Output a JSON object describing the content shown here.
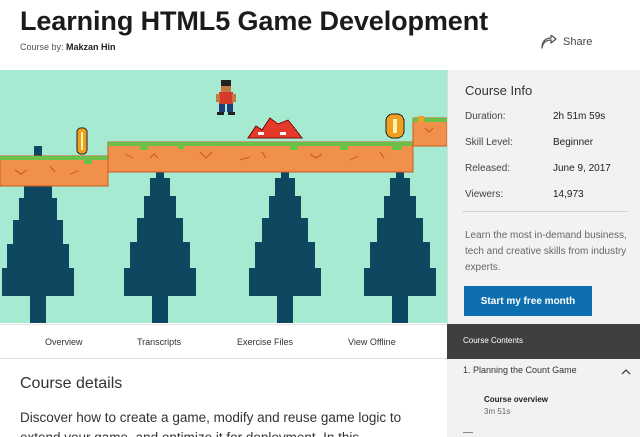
{
  "header": {
    "title": "Learning HTML5 Game Development",
    "byline_prefix": "Course by:",
    "author": "Makzan Hin",
    "share_label": "Share",
    "share_icon": "share-arrow-icon"
  },
  "course_info": {
    "title": "Course Info",
    "rows": [
      {
        "label": "Duration:",
        "value": "2h 51m 59s"
      },
      {
        "label": "Skill Level:",
        "value": "Beginner"
      },
      {
        "label": "Released:",
        "value": "June 9, 2017"
      },
      {
        "label": "Viewers:",
        "value": "14,973"
      }
    ],
    "description": "Learn the most in-demand business, tech and creative skills from industry experts.",
    "cta_label": "Start my free month",
    "cta_color": "#0d6faf"
  },
  "tabs": [
    "Overview",
    "Transcripts",
    "Exercise Files",
    "View Offline"
  ],
  "details": {
    "title": "Course details",
    "text": "Discover how to create a game, modify and reuse game logic to extend your game, and optimize it for deployment. In this"
  },
  "contents": {
    "header": "Course Contents",
    "chapter": "1. Planning the Count Game",
    "chapter_icon": "chevron-up-icon",
    "lesson_title": "Course overview",
    "lesson_duration": "3m 51s"
  },
  "colors": {
    "hero_bg": "#a6ead2",
    "platform": "#f0904a",
    "grass": "#6cc04a",
    "tree": "#0f4660",
    "coin": "#f0a020"
  }
}
